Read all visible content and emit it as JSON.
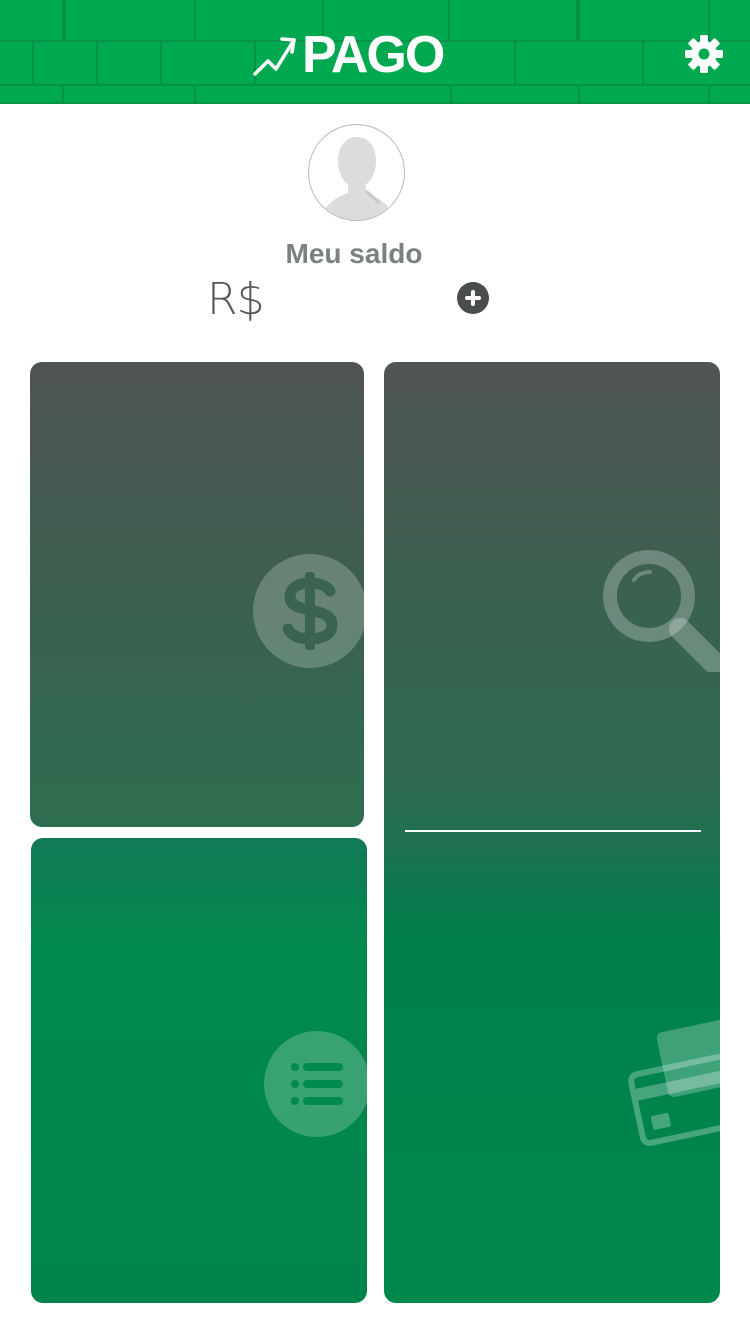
{
  "header": {
    "logo_text": "PAGO",
    "icons": {
      "logo_mark": "trend-arrow-icon",
      "settings": "gear-icon"
    },
    "colors": {
      "background": "#00a84f",
      "brick_line": "#089248"
    }
  },
  "profile": {
    "avatar_icon": "user-silhouette-icon",
    "balance_label": "Meu saldo",
    "currency_symbol": "R$",
    "add_balance_icon": "plus-circle-icon"
  },
  "cards": [
    {
      "icon": "dollar-circle-icon"
    },
    {
      "icon": "list-circle-icon"
    },
    {
      "icon": "search-icon",
      "second_icon": "credit-card-icon"
    }
  ],
  "colors": {
    "card_dark": "#4f5452",
    "card_green": "#00884c",
    "label_gray": "#7b8080",
    "add_button": "#4a4d4d"
  }
}
